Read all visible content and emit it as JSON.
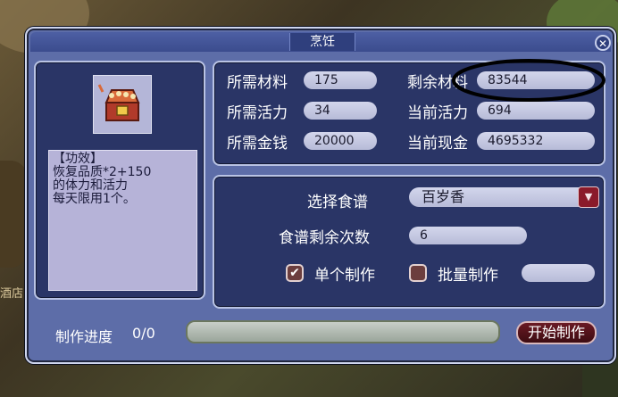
{
  "background": {
    "sign_text": "酒店"
  },
  "dialog": {
    "title": "烹饪",
    "close_icon": "close-x",
    "item": {
      "icon": "treasure-chest-icon",
      "desc_lines": [
        "【功效】",
        "恢复品质*2+150",
        "的体力和活力",
        "每天限用1个。"
      ]
    },
    "stats": {
      "material_need_label": "所需材料",
      "material_need": "175",
      "material_left_label": "剩余材料",
      "material_left": "83544",
      "energy_need_label": "所需活力",
      "energy_need": "34",
      "energy_now_label": "当前活力",
      "energy_now": "694",
      "money_need_label": "所需金钱",
      "money_need": "20000",
      "money_now_label": "当前现金",
      "money_now": "4695332"
    },
    "recipe": {
      "select_label": "选择食谱",
      "selected": "百岁香",
      "remaining_label": "食谱剩余次数",
      "remaining": "6",
      "single_label": "单个制作",
      "single_checked": true,
      "batch_label": "批量制作",
      "batch_checked": false,
      "batch_value": ""
    },
    "progress": {
      "label": "制作进度",
      "value": "0/0",
      "fraction": 0
    },
    "start_button": "开始制作"
  },
  "colors": {
    "dialog": "#5d6da8",
    "panel": "#2a3566",
    "field": "#c5c8e2",
    "button": "#5a1520"
  }
}
